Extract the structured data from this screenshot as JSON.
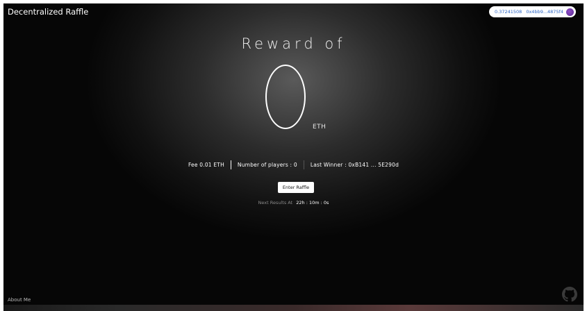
{
  "header": {
    "title": "Decentralized Raffle"
  },
  "wallet": {
    "balance": "0.37241508",
    "address": "0x4bb9...4875f4"
  },
  "reward": {
    "heading": "Reward of",
    "amount": "0",
    "unit": "ETH"
  },
  "stats": {
    "fee": "Fee 0.01 ETH",
    "players": "Number of players : 0",
    "last_winner": "Last Winner : 0xB141 ... 5E290d"
  },
  "actions": {
    "enter_label": "Enter Raffle"
  },
  "next_results": {
    "label": "Next Results At",
    "timer": "22h : 10m : 0s"
  },
  "footer": {
    "about_label": "About Me",
    "github_icon": "github-icon"
  },
  "colors": {
    "background": "#0a0a0a",
    "glow": "#5a5a5a",
    "text": "#ffffff",
    "wallet_text": "#2a64c5",
    "avatar": "#7a3fb8"
  }
}
